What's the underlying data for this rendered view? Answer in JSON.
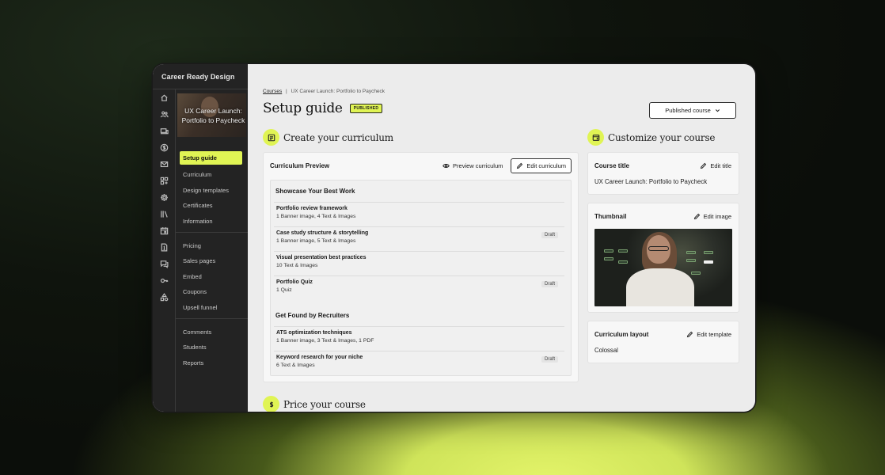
{
  "app": {
    "brand": "Career Ready Design"
  },
  "sidebar": {
    "course_thumb_text": "UX Career Launch: Portfolio to Paycheck",
    "rail_icons": [
      "home-icon",
      "users-icon",
      "devices-icon",
      "dollar-icon",
      "mail-icon",
      "apps-icon",
      "gear-icon",
      "library-icon",
      "calendar-icon",
      "document-icon",
      "chat-icon",
      "key-icon",
      "shapes-icon"
    ],
    "groups": [
      [
        "Setup guide",
        "Curriculum",
        "Design templates",
        "Certificates",
        "Information"
      ],
      [
        "Pricing",
        "Sales pages",
        "Embed",
        "Coupons",
        "Upsell funnel"
      ],
      [
        "Comments",
        "Students",
        "Reports"
      ]
    ]
  },
  "breadcrumb": {
    "root": "Courses",
    "sep": "|",
    "current": "UX Career Launch: Portfolio to Paycheck"
  },
  "page": {
    "title": "Setup guide",
    "badge": "PUBLISHED",
    "status_button": "Published course"
  },
  "curriculum": {
    "section_title": "Create your curriculum",
    "card_title": "Curriculum Preview",
    "preview_label": "Preview curriculum",
    "edit_label": "Edit curriculum",
    "modules": [
      {
        "title": "Showcase Your Best Work",
        "lessons": [
          {
            "name": "Portfolio review framework",
            "summary": "1 Banner image, 4 Text & Images",
            "draft": ""
          },
          {
            "name": "Case study structure & storytelling",
            "summary": "1 Banner image, 5 Text & Images",
            "draft": "Draft"
          },
          {
            "name": "Visual presentation best practices",
            "summary": "10 Text & Images",
            "draft": ""
          },
          {
            "name": "Portfolio Quiz",
            "summary": "1 Quiz",
            "draft": "Draft"
          }
        ]
      },
      {
        "title": "Get Found by Recruiters",
        "lessons": [
          {
            "name": "ATS optimization techniques",
            "summary": "1 Banner image, 3 Text & Images, 1 PDF",
            "draft": ""
          },
          {
            "name": "Keyword research for your niche",
            "summary": "6 Text & Images",
            "draft": "Draft"
          }
        ]
      }
    ]
  },
  "customize": {
    "section_title": "Customize your course",
    "course_title_label": "Course title",
    "edit_title": "Edit title",
    "course_title_value": "UX Career Launch: Portfolio to Paycheck",
    "thumbnail_label": "Thumbnail",
    "edit_image": "Edit image",
    "layout_label": "Curriculum layout",
    "edit_template": "Edit template",
    "layout_value": "Colossal"
  },
  "price": {
    "section_title": "Price your course"
  },
  "colors": {
    "accent": "#e0f454",
    "sidebar": "#232323",
    "canvas": "#ececec"
  }
}
